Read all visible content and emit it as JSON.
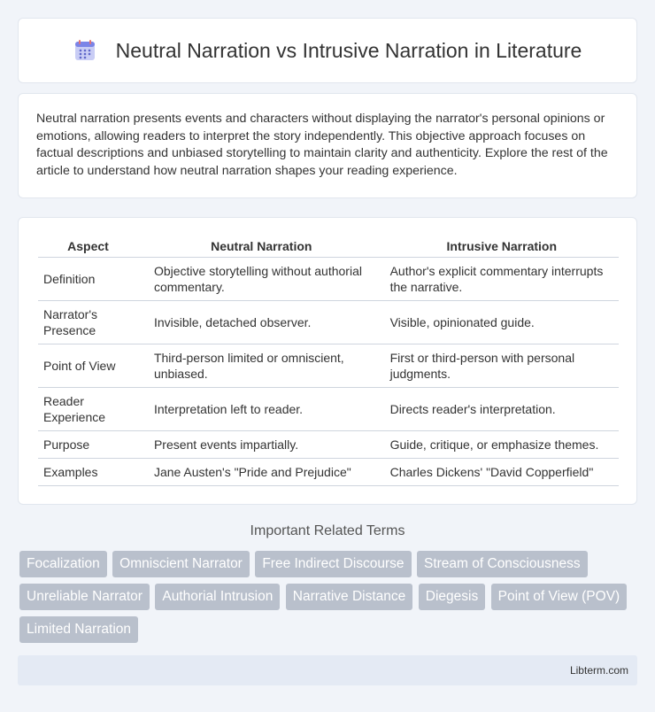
{
  "header": {
    "title": "Neutral Narration vs Intrusive Narration in Literature",
    "icon": "document-list-icon"
  },
  "intro": {
    "text": "Neutral narration presents events and characters without displaying the narrator's personal opinions or emotions, allowing readers to interpret the story independently. This objective approach focuses on factual descriptions and unbiased storytelling to maintain clarity and authenticity. Explore the rest of the article to understand how neutral narration shapes your reading experience."
  },
  "table": {
    "headers": [
      "Aspect",
      "Neutral Narration",
      "Intrusive Narration"
    ],
    "rows": [
      [
        "Definition",
        "Objective storytelling without authorial commentary.",
        "Author's explicit commentary interrupts the narrative."
      ],
      [
        "Narrator's Presence",
        "Invisible, detached observer.",
        "Visible, opinionated guide."
      ],
      [
        "Point of View",
        "Third-person limited or omniscient, unbiased.",
        "First or third-person with personal judgments."
      ],
      [
        "Reader Experience",
        "Interpretation left to reader.",
        "Directs reader's interpretation."
      ],
      [
        "Purpose",
        "Present events impartially.",
        "Guide, critique, or emphasize themes."
      ],
      [
        "Examples",
        "Jane Austen's \"Pride and Prejudice\"",
        "Charles Dickens' \"David Copperfield\""
      ]
    ]
  },
  "related": {
    "title": "Important Related Terms",
    "tags": [
      "Focalization",
      "Omniscient Narrator",
      "Free Indirect Discourse",
      "Stream of Consciousness",
      "Unreliable Narrator",
      "Authorial Intrusion",
      "Narrative Distance",
      "Diegesis",
      "Point of View (POV)",
      "Limited Narration"
    ]
  },
  "footer": {
    "site": "Libterm.com"
  }
}
